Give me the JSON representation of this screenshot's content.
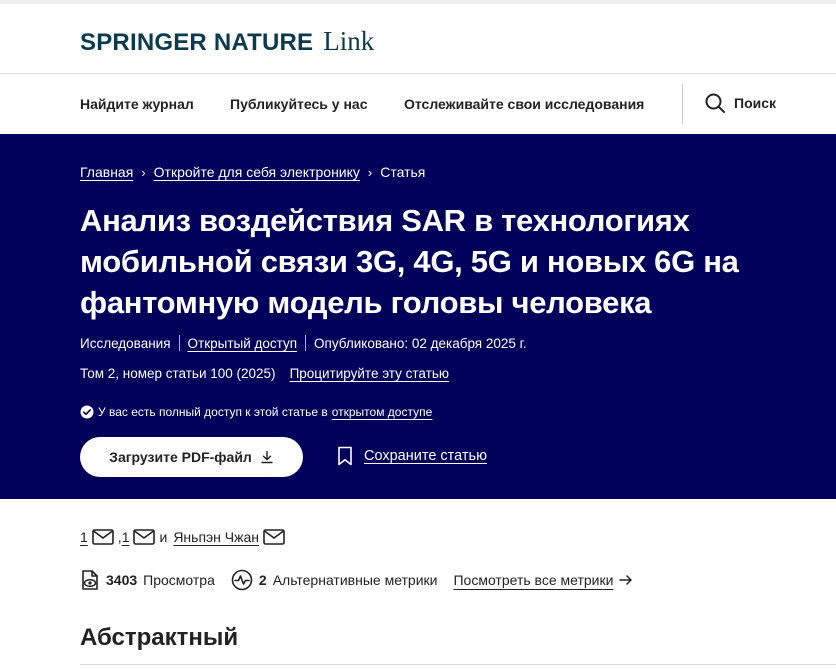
{
  "header": {
    "brand": "SPRINGER NATURE",
    "brand_suffix": "Link"
  },
  "nav": {
    "items": [
      {
        "label": "Найдите журнал"
      },
      {
        "label": "Публикуйтесь у нас"
      },
      {
        "label": "Отслеживайте свои исследования"
      }
    ],
    "search_label": "Поиск"
  },
  "breadcrumb": {
    "home": "Главная",
    "section": "Откройте для себя электронику",
    "current": "Статья"
  },
  "article": {
    "title": "Анализ воздействия SAR в технологиях мобильной связи 3G, 4G, 5G и новых 6G на фантомную модель головы человека",
    "type": "Исследования",
    "access_type": "Открытый доступ",
    "published": "Опубликовано: 02 декабря 2025 г.",
    "volume": "Том 2, номер статьи 100 (2025)",
    "cite_label": "Процитируйте эту статью",
    "access_note_prefix": "У вас есть полный доступ к этой статье в",
    "access_note_link": "открытом доступе",
    "download_label": "Загрузите PDF-файл",
    "save_label": "Сохраните статью"
  },
  "authors": {
    "first_sup": "1",
    "second_sup": "1",
    "conjunction": "и",
    "last_author": "Яньпэн Чжан"
  },
  "metrics": {
    "views_count": "3403",
    "views_label": "Просмотра",
    "altmetric_count": "2",
    "altmetric_label": "Альтернативные метрики",
    "all_metrics_label": "Посмотреть все метрики"
  },
  "sections": {
    "abstract_heading": "Абстрактный"
  },
  "colors": {
    "hero_bg": "#01005b",
    "brand": "#0c3a4d"
  }
}
